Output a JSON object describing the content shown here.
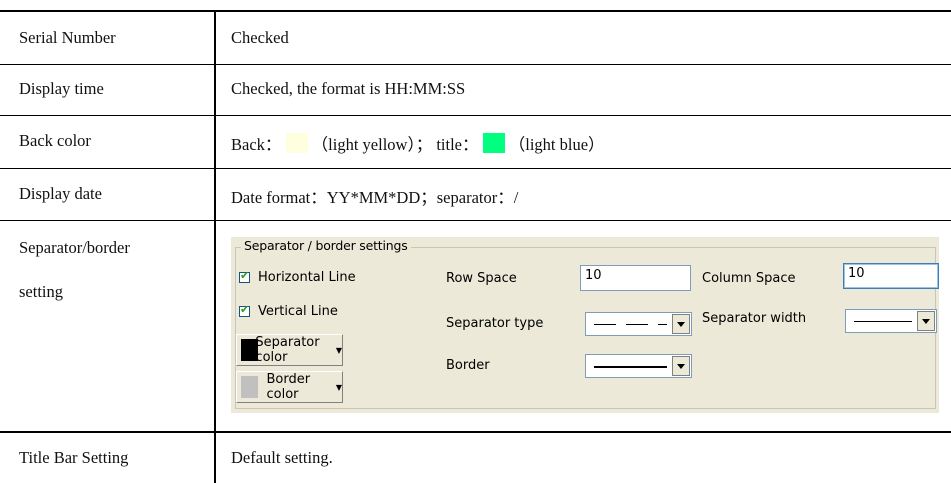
{
  "rows": [
    {
      "label": "Serial Number",
      "value": "Checked"
    },
    {
      "label": "Display time",
      "value": "Checked, the format is HH:MM:SS"
    },
    {
      "label": "Back color",
      "back_prefix": "Back：",
      "back_name": "（light yellow）；",
      "title_prefix": " title：",
      "title_name": "（light blue）"
    },
    {
      "label": "Display date",
      "value": "Date format：YY*MM*DD；separator：/"
    },
    {
      "label_line1": "Separator/border",
      "label_line2": "setting"
    },
    {
      "label": "Title Bar Setting",
      "value": "Default setting."
    }
  ],
  "colors": {
    "light_yellow": "#ffffe0",
    "light_blue": "#00ff7f",
    "separator": "#000000",
    "border": "#c0c0c0"
  },
  "panel": {
    "legend": "Separator / border settings",
    "horizontal_line": {
      "label": "Horizontal Line",
      "checked": true
    },
    "vertical_line": {
      "label": "Vertical Line",
      "checked": true
    },
    "separator_color_button": "Separator color",
    "border_color_button": "Border color",
    "row_space_label": "Row Space",
    "row_space_value": "10",
    "column_space_label": "Column Space",
    "column_space_value": "10",
    "separator_type_label": "Separator type",
    "separator_width_label": "Separator width",
    "border_label": "Border"
  }
}
